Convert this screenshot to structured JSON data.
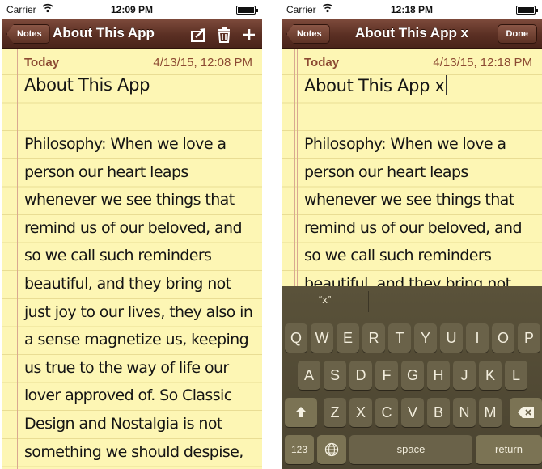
{
  "left": {
    "status": {
      "carrier": "Carrier",
      "time": "12:09 PM"
    },
    "nav": {
      "back_label": "Notes",
      "title": "About This App"
    },
    "note": {
      "date_label": "Today",
      "date": "4/13/15, 12:08 PM",
      "title": "About This App",
      "lines": [
        "Philosophy: When we love a",
        "person our heart leaps",
        "whenever we see things that",
        "remind us of our beloved, and",
        "so we call such reminders",
        "beautiful, and they bring not",
        "just joy to our lives, they also in",
        "a sense magnetize us, keeping",
        "us true to the way of life our",
        "lover approved of. So Classic",
        "Design and Nostalgia is not",
        "something we should despise,"
      ]
    },
    "icons": [
      "share-icon",
      "trash-icon",
      "add-icon"
    ]
  },
  "right": {
    "status": {
      "carrier": "Carrier",
      "time": "12:18 PM"
    },
    "nav": {
      "back_label": "Notes",
      "title": "About This App x",
      "done_label": "Done"
    },
    "note": {
      "date_label": "Today",
      "date": "4/13/15, 12:18 PM",
      "title": "About This App x",
      "lines": [
        "Philosophy: When we love a",
        "person our heart leaps",
        "whenever we see things that",
        "remind us of our beloved, and",
        "so we call such reminders",
        "beautiful, and they bring not"
      ]
    },
    "keyboard": {
      "suggestion": "“x”",
      "row1": [
        "Q",
        "W",
        "E",
        "R",
        "T",
        "Y",
        "U",
        "I",
        "O",
        "P"
      ],
      "row2": [
        "A",
        "S",
        "D",
        "F",
        "G",
        "H",
        "J",
        "K",
        "L"
      ],
      "row3": [
        "Z",
        "X",
        "C",
        "V",
        "B",
        "N",
        "M"
      ],
      "numbers_label": "123",
      "space_label": "space",
      "return_label": "return"
    }
  },
  "colors": {
    "paper": "#fdf6b4",
    "nav_bar": "#5a2f23",
    "date_text": "#8c4a33",
    "keyboard": "#4f4834"
  }
}
